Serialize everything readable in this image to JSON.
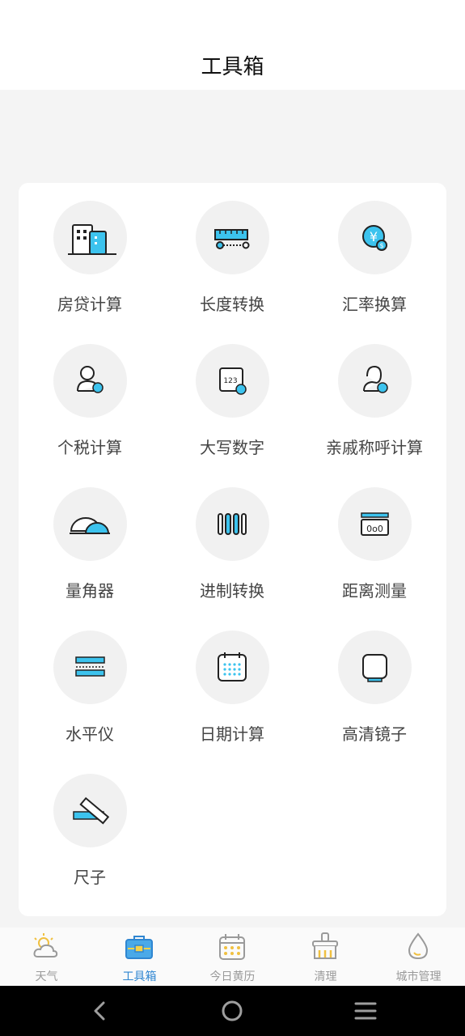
{
  "header": {
    "title": "工具箱"
  },
  "tools": [
    {
      "label": "房贷计算",
      "icon": "building-loan-icon"
    },
    {
      "label": "长度转换",
      "icon": "ruler-tape-icon"
    },
    {
      "label": "汇率换算",
      "icon": "currency-exchange-icon"
    },
    {
      "label": "个税计算",
      "icon": "person-tax-icon"
    },
    {
      "label": "大写数字",
      "icon": "number-uppercase-icon"
    },
    {
      "label": "亲戚称呼计算",
      "icon": "relative-person-icon"
    },
    {
      "label": "量角器",
      "icon": "protractor-icon"
    },
    {
      "label": "进制转换",
      "icon": "base-convert-icon"
    },
    {
      "label": "距离测量",
      "icon": "distance-measure-icon"
    },
    {
      "label": "水平仪",
      "icon": "level-icon"
    },
    {
      "label": "日期计算",
      "icon": "calendar-icon"
    },
    {
      "label": "高清镜子",
      "icon": "mirror-icon"
    },
    {
      "label": "尺子",
      "icon": "ruler-icon"
    }
  ],
  "tabbar": {
    "items": [
      {
        "label": "天气",
        "icon": "weather-icon",
        "active": false
      },
      {
        "label": "工具箱",
        "icon": "toolbox-icon",
        "active": true
      },
      {
        "label": "今日黄历",
        "icon": "almanac-icon",
        "active": false
      },
      {
        "label": "清理",
        "icon": "broom-icon",
        "active": false
      },
      {
        "label": "城市管理",
        "icon": "drop-icon",
        "active": false
      }
    ]
  },
  "colors": {
    "accent": "#3cc3ee",
    "tab_active": "#2f86d1",
    "tab_inactive": "#9a9a9a",
    "icon_bg": "#f1f1f1"
  }
}
